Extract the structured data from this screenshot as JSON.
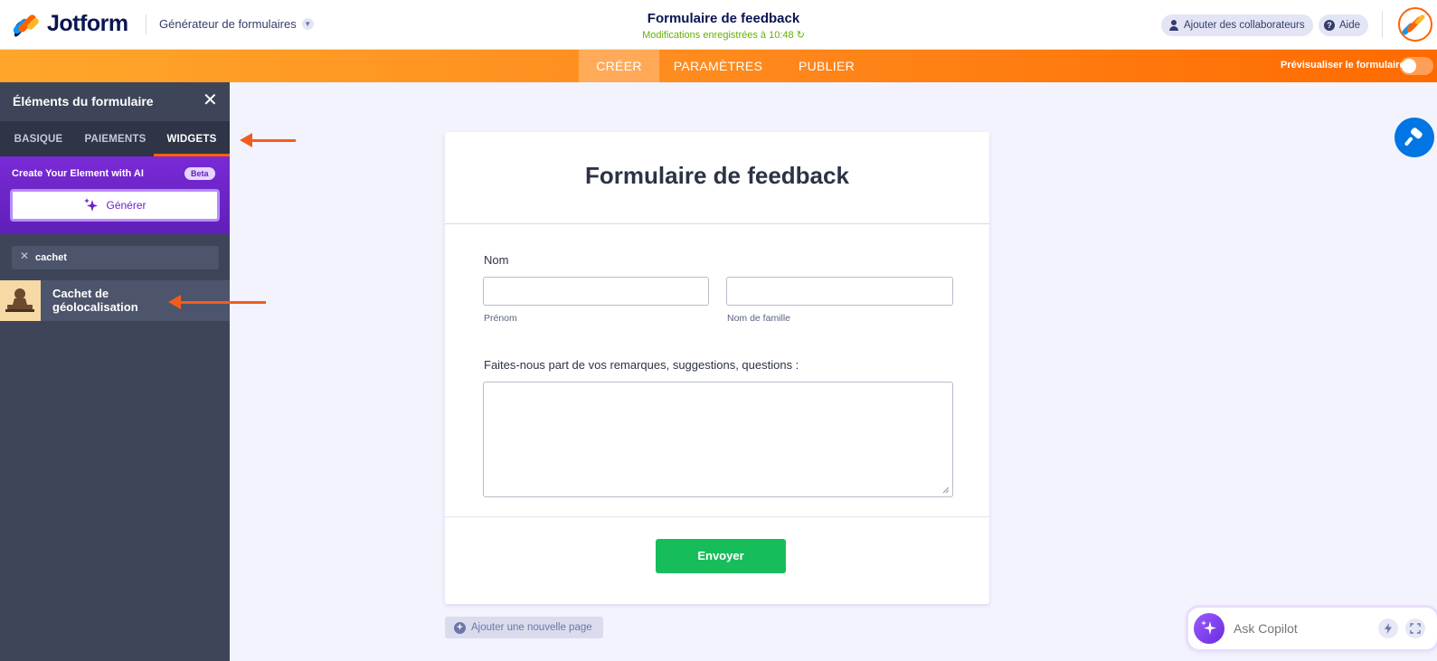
{
  "header": {
    "brand": "Jotform",
    "builder_menu": "Générateur de formulaires",
    "form_title": "Formulaire de feedback",
    "saved_status": "Modifications enregistrées à 10:48",
    "collab_button": "Ajouter des collaborateurs",
    "help_button": "Aide"
  },
  "nav": {
    "tabs": [
      {
        "label": "CRÉER",
        "active": true
      },
      {
        "label": "PARAMÈTRES",
        "active": false
      },
      {
        "label": "PUBLIER",
        "active": false
      }
    ],
    "preview_label": "Prévisualiser le formulaire"
  },
  "sidebar": {
    "title": "Éléments du formulaire",
    "tabs": [
      {
        "label": "BASIQUE",
        "active": false
      },
      {
        "label": "PAIEMENTS",
        "active": false
      },
      {
        "label": "WIDGETS",
        "active": true
      }
    ],
    "ai": {
      "title": "Create Your Element with AI",
      "badge": "Beta",
      "button": "Générer"
    },
    "search": {
      "value": "cachet"
    },
    "results": [
      {
        "label": "Cachet de géolocalisation",
        "icon": "stamp-icon"
      }
    ]
  },
  "form": {
    "heading": "Formulaire de feedback",
    "name_label": "Nom",
    "first_sublabel": "Prénom",
    "last_sublabel": "Nom de famille",
    "comments_label": "Faites-nous part de vos remarques, suggestions, questions :",
    "submit": "Envoyer",
    "add_page": "Ajouter une nouvelle page"
  },
  "copilot": {
    "placeholder": "Ask Copilot"
  },
  "colors": {
    "accent_orange": "#ff6100",
    "nav_gradient_start": "#ffa62a",
    "submit_green": "#18bd5b",
    "sidebar_bg": "#3e4559",
    "ai_purple": "#6a2be0",
    "designer_blue": "#0075e3",
    "annotation_arrow": "#f25c1e"
  }
}
